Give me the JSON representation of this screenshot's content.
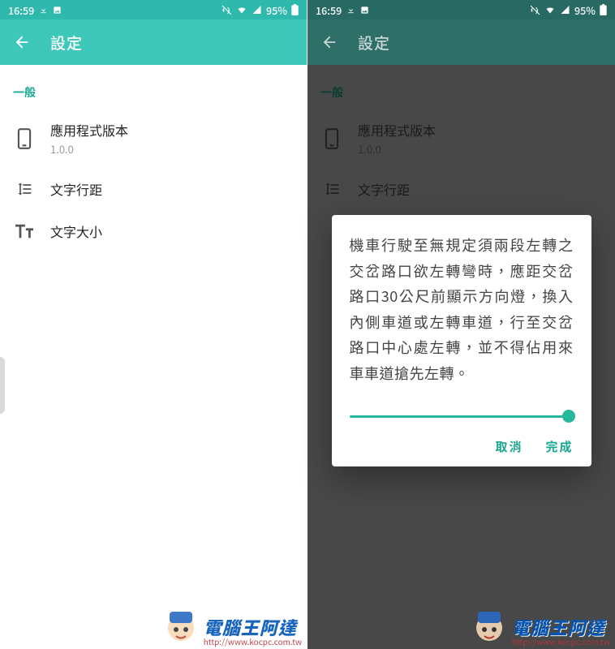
{
  "statusbar": {
    "time": "16:59",
    "battery_pct": "95%"
  },
  "appbar": {
    "title": "設定"
  },
  "section": {
    "header": "一般",
    "app_version_label": "應用程式版本",
    "app_version_value": "1.0.0",
    "line_spacing_label": "文字行距",
    "text_size_label": "文字大小"
  },
  "dialog": {
    "body": "機車行駛至無規定須兩段左轉之交岔路口欲左轉彎時，應距交岔路口30公尺前顯示方向燈，換入內側車道或左轉車道，行至交岔路口中心處左轉，並不得佔用來車車道搶先左轉。",
    "cancel": "取消",
    "done": "完成"
  },
  "watermark": {
    "line1": "電腦王阿達",
    "line2": "http://www.kocpc.com.tw"
  }
}
